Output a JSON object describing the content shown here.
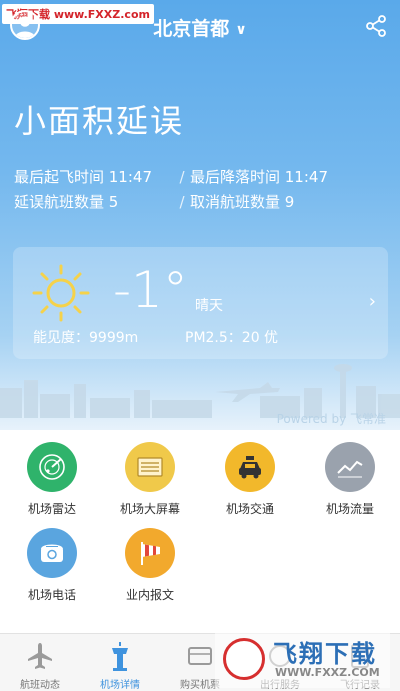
{
  "header": {
    "watermark": "飞翔下载 www.FXXZ.com",
    "title": "北京首都"
  },
  "status": {
    "headline": "小面积延误",
    "last_takeoff": "最后起飞时间 11:47",
    "last_landing": "最后降落时间 11:47",
    "delayed_count": "延误航班数量 5",
    "cancelled_count": "取消航班数量 9",
    "separator": "/"
  },
  "weather": {
    "temperature": "-1°",
    "condition": "晴天",
    "visibility": "能见度：9999m",
    "pm25": "PM2.5：20 优",
    "icon": "sun-icon"
  },
  "powered_by": "Powered by 飞常准",
  "services": [
    {
      "label": "机场雷达",
      "icon": "radar-icon",
      "color": "#2fb36b"
    },
    {
      "label": "机场大屏幕",
      "icon": "screen-icon",
      "color": "#f0c94a"
    },
    {
      "label": "机场交通",
      "icon": "taxi-icon",
      "color": "#f2b82b"
    },
    {
      "label": "机场流量",
      "icon": "flow-chart-icon",
      "color": "#9aa2ad"
    },
    {
      "label": "机场电话",
      "icon": "phone-icon",
      "color": "#5aa5df"
    },
    {
      "label": "业内报文",
      "icon": "windsock-icon",
      "color": "#f2a92d"
    }
  ],
  "tabs": [
    {
      "label": "航班动态",
      "icon": "plane-icon"
    },
    {
      "label": "机场详情",
      "icon": "tower-icon",
      "active": true
    },
    {
      "label": "购买机票",
      "icon": "ticket-icon"
    },
    {
      "label": "出行服务",
      "icon": "service-icon"
    },
    {
      "label": "飞行记录",
      "icon": "record-icon"
    }
  ],
  "bottom_watermark": {
    "title": "飞翔下载",
    "url": "WWW.FXXZ.COM"
  }
}
